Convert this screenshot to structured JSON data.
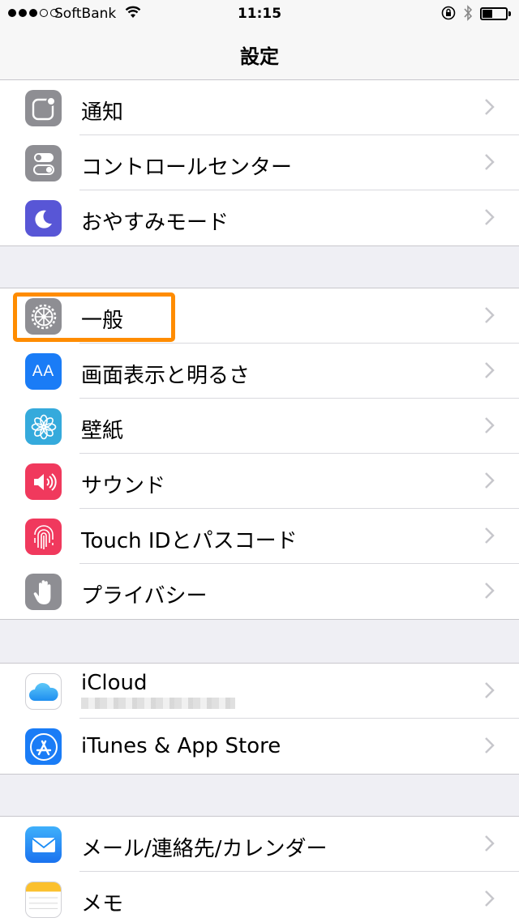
{
  "status_bar": {
    "carrier": "SoftBank",
    "time": "11:15"
  },
  "nav": {
    "title": "設定"
  },
  "groups": [
    {
      "items": [
        {
          "label": "通知",
          "icon": "notifications-icon",
          "color": "#8e8e93"
        },
        {
          "label": "コントロールセンター",
          "icon": "control-center-icon",
          "color": "#8e8e93"
        },
        {
          "label": "おやすみモード",
          "icon": "moon-icon",
          "color": "#5856d6"
        }
      ]
    },
    {
      "items": [
        {
          "label": "一般",
          "icon": "gear-icon",
          "color": "#8e8e93"
        },
        {
          "label": "画面表示と明るさ",
          "icon": "display-text-icon",
          "color": "#1a7cf6",
          "icon_text": "AA"
        },
        {
          "label": "壁紙",
          "icon": "wallpaper-flower-icon",
          "color": "#35aadc"
        },
        {
          "label": "サウンド",
          "icon": "speaker-icon",
          "color": "#f0395d"
        },
        {
          "label": "Touch IDとパスコード",
          "icon": "fingerprint-icon",
          "color": "#f0395d"
        },
        {
          "label": "プライバシー",
          "icon": "hand-icon",
          "color": "#8e8e93"
        }
      ]
    },
    {
      "items": [
        {
          "label": "iCloud",
          "icon": "icloud-icon",
          "color": "#ffffff"
        },
        {
          "label": "iTunes & App Store",
          "icon": "app-store-icon",
          "color": "#1a7cf6"
        }
      ]
    },
    {
      "items": [
        {
          "label": "メール/連絡先/カレンダー",
          "icon": "mail-icon",
          "color": "#1a8cf6"
        },
        {
          "label": "メモ",
          "icon": "notes-icon",
          "color": "#ffffff"
        }
      ]
    }
  ],
  "highlight_color": "#ff8c00"
}
